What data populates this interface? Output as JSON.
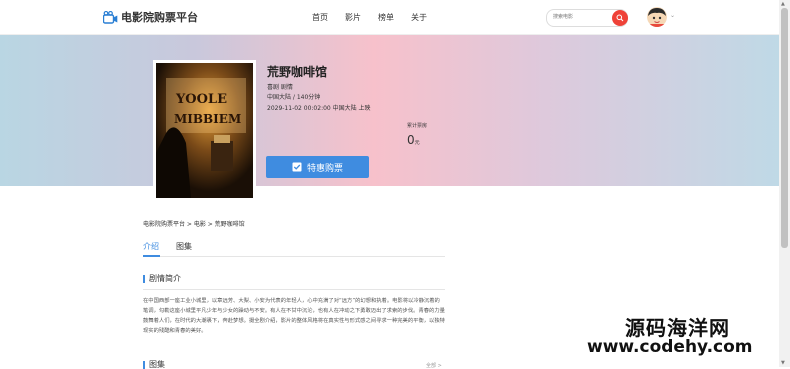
{
  "header": {
    "brand": "电影院购票平台",
    "nav": [
      "首页",
      "影片",
      "榜单",
      "关于"
    ],
    "search_placeholder": "搜索电影"
  },
  "movie": {
    "title": "荒野咖啡馆",
    "genre": "喜剧 剧情",
    "region_duration": "中国大陆 / 140分钟",
    "release": "2029-11-02 00:02:00 中国大陆 上映",
    "box_office_label": "累计票房",
    "box_office_value": "0",
    "box_office_unit": "元",
    "buy_label": "特惠购票",
    "poster_text_1": "YOOLE",
    "poster_text_2": "MIBBIEM"
  },
  "breadcrumb": "电影院购票平台 > 电影 > 荒野咖啡馆",
  "tabs": [
    "介绍",
    "图集"
  ],
  "synopsis": {
    "title": "剧情简介",
    "text": "在中国西部一座工业小城里，以章远芳、大梨、小安为代表的年轻人，心中充满了对“远方”的幻想和执着。电影将以冷静沉着的笔调，勾勒这座小城里平凡少年与少女的躁动与不安。有人在不甘中沉沦，也有人在冲动之下勇敢迈出了求索的步伐。青春的力量鼓舞着人们，在时代的大潮裹下，奔赴梦想。摄全剧介绍，影片的整体风格将在真实性与形式感之间寻求一种完美的平衡，以独特现实的残酷和青春的美好。"
  },
  "gallery": {
    "title": "图集",
    "all_link": "全部 >"
  },
  "watermark": {
    "cn": "源码海洋网",
    "url": "www.codehy.com"
  }
}
